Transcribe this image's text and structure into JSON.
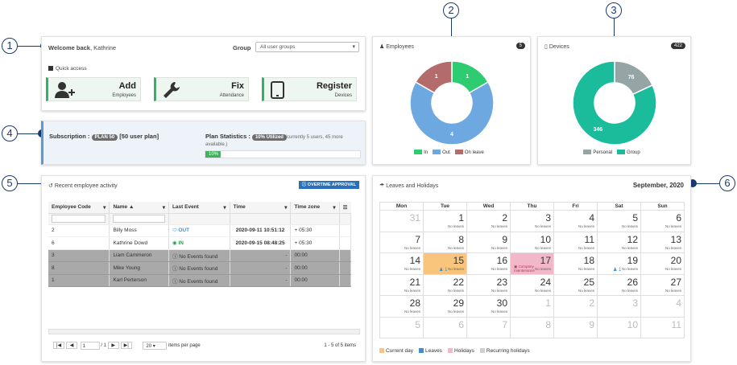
{
  "callouts": [
    "1",
    "2",
    "3",
    "4",
    "5",
    "6"
  ],
  "welcome": {
    "prefix": "Welcome back",
    "name": ", Kathrine",
    "group_label": "Group",
    "group_value": "All user groups"
  },
  "quick_access": {
    "title": "Quick access",
    "items": [
      {
        "title": "Add",
        "sub": "Employees",
        "icon": "add-user-icon"
      },
      {
        "title": "Fix",
        "sub": "Attendance",
        "icon": "wrench-icon"
      },
      {
        "title": "Register",
        "sub": "Devices",
        "icon": "tablet-icon"
      }
    ]
  },
  "subscription": {
    "label": "Subscription :",
    "plan_badge": "PLAN 50",
    "plan_text": "[50 user plan]",
    "stats_label": "Plan Statistics :",
    "utilized_badge": "10% Utilized",
    "stats_note": "(currently 5 users, 45 more available.)",
    "progress_label": "10%",
    "progress": 0.1
  },
  "employees": {
    "title": "Employees",
    "count": "5",
    "legend": [
      "In",
      "Out",
      "On leave"
    ],
    "colors": [
      "#2ecc71",
      "#6ea8e0",
      "#b36b6b"
    ],
    "chart_data": {
      "type": "pie",
      "categories": [
        "In",
        "Out",
        "On leave"
      ],
      "values": [
        1,
        4,
        1
      ]
    }
  },
  "devices": {
    "title": "Devices",
    "count": "422",
    "legend": [
      "Personal",
      "Group"
    ],
    "colors": [
      "#95a5a6",
      "#1abc9c"
    ],
    "chart_data": {
      "type": "pie",
      "categories": [
        "Personal",
        "Group"
      ],
      "values": [
        76,
        346
      ]
    }
  },
  "activity": {
    "title": "Recent employee activity",
    "overtime_btn": "OVERTIME APPROVAL",
    "headers": [
      "Employee Code",
      "Name",
      "Last Event",
      "Time",
      "Time zone"
    ],
    "rows": [
      {
        "code": "2",
        "name": "Billy Moss",
        "event": "OUT",
        "time": "2020-09-11 10:51:12",
        "tz": "+ 05:30",
        "type": "out"
      },
      {
        "code": "6",
        "name": "Kathrine Dowd",
        "event": "IN",
        "time": "2020-09-15 08:48:25",
        "tz": "+ 05:30",
        "type": "in"
      },
      {
        "code": "3",
        "name": "Liam Cammeron",
        "event": "No Events found",
        "time": "-",
        "tz": "00:00",
        "type": "none"
      },
      {
        "code": "8",
        "name": "Mike Young",
        "event": "No Events found",
        "time": "-",
        "tz": "00:00",
        "type": "none"
      },
      {
        "code": "1",
        "name": "Karl Perterson",
        "event": "No Events found",
        "time": "-",
        "tz": "00:00",
        "type": "none"
      }
    ],
    "pager": {
      "page": "1",
      "total": "/ 1",
      "per_page": "20",
      "per_page_label": "items per page",
      "summary": "1 - 5 of 5 items"
    }
  },
  "calendar": {
    "title": "Leaves and Holidays",
    "month": "September, 2020",
    "days": [
      "Mon",
      "Tue",
      "Wed",
      "Thu",
      "Fri",
      "Sat",
      "Sun"
    ],
    "no_leaves": "No leaves",
    "weeks": [
      [
        "31",
        "1",
        "2",
        "3",
        "4",
        "5",
        "6"
      ],
      [
        "7",
        "8",
        "9",
        "10",
        "11",
        "12",
        "13"
      ],
      [
        "14",
        "15",
        "16",
        "17",
        "18",
        "19",
        "20"
      ],
      [
        "21",
        "22",
        "23",
        "24",
        "25",
        "26",
        "27"
      ],
      [
        "28",
        "29",
        "30",
        "1",
        "2",
        "3",
        "4"
      ],
      [
        "5",
        "6",
        "7",
        "8",
        "9",
        "10",
        "11"
      ]
    ],
    "leave_count": "1",
    "holiday_name": "Company maintenance",
    "legend": [
      "Current day",
      "Leaves",
      "Holidays",
      "Recurring holidays"
    ],
    "legend_colors": [
      "#f9c57c",
      "#3d8fd1",
      "#f2b7c8",
      "#cfcfcf"
    ]
  }
}
